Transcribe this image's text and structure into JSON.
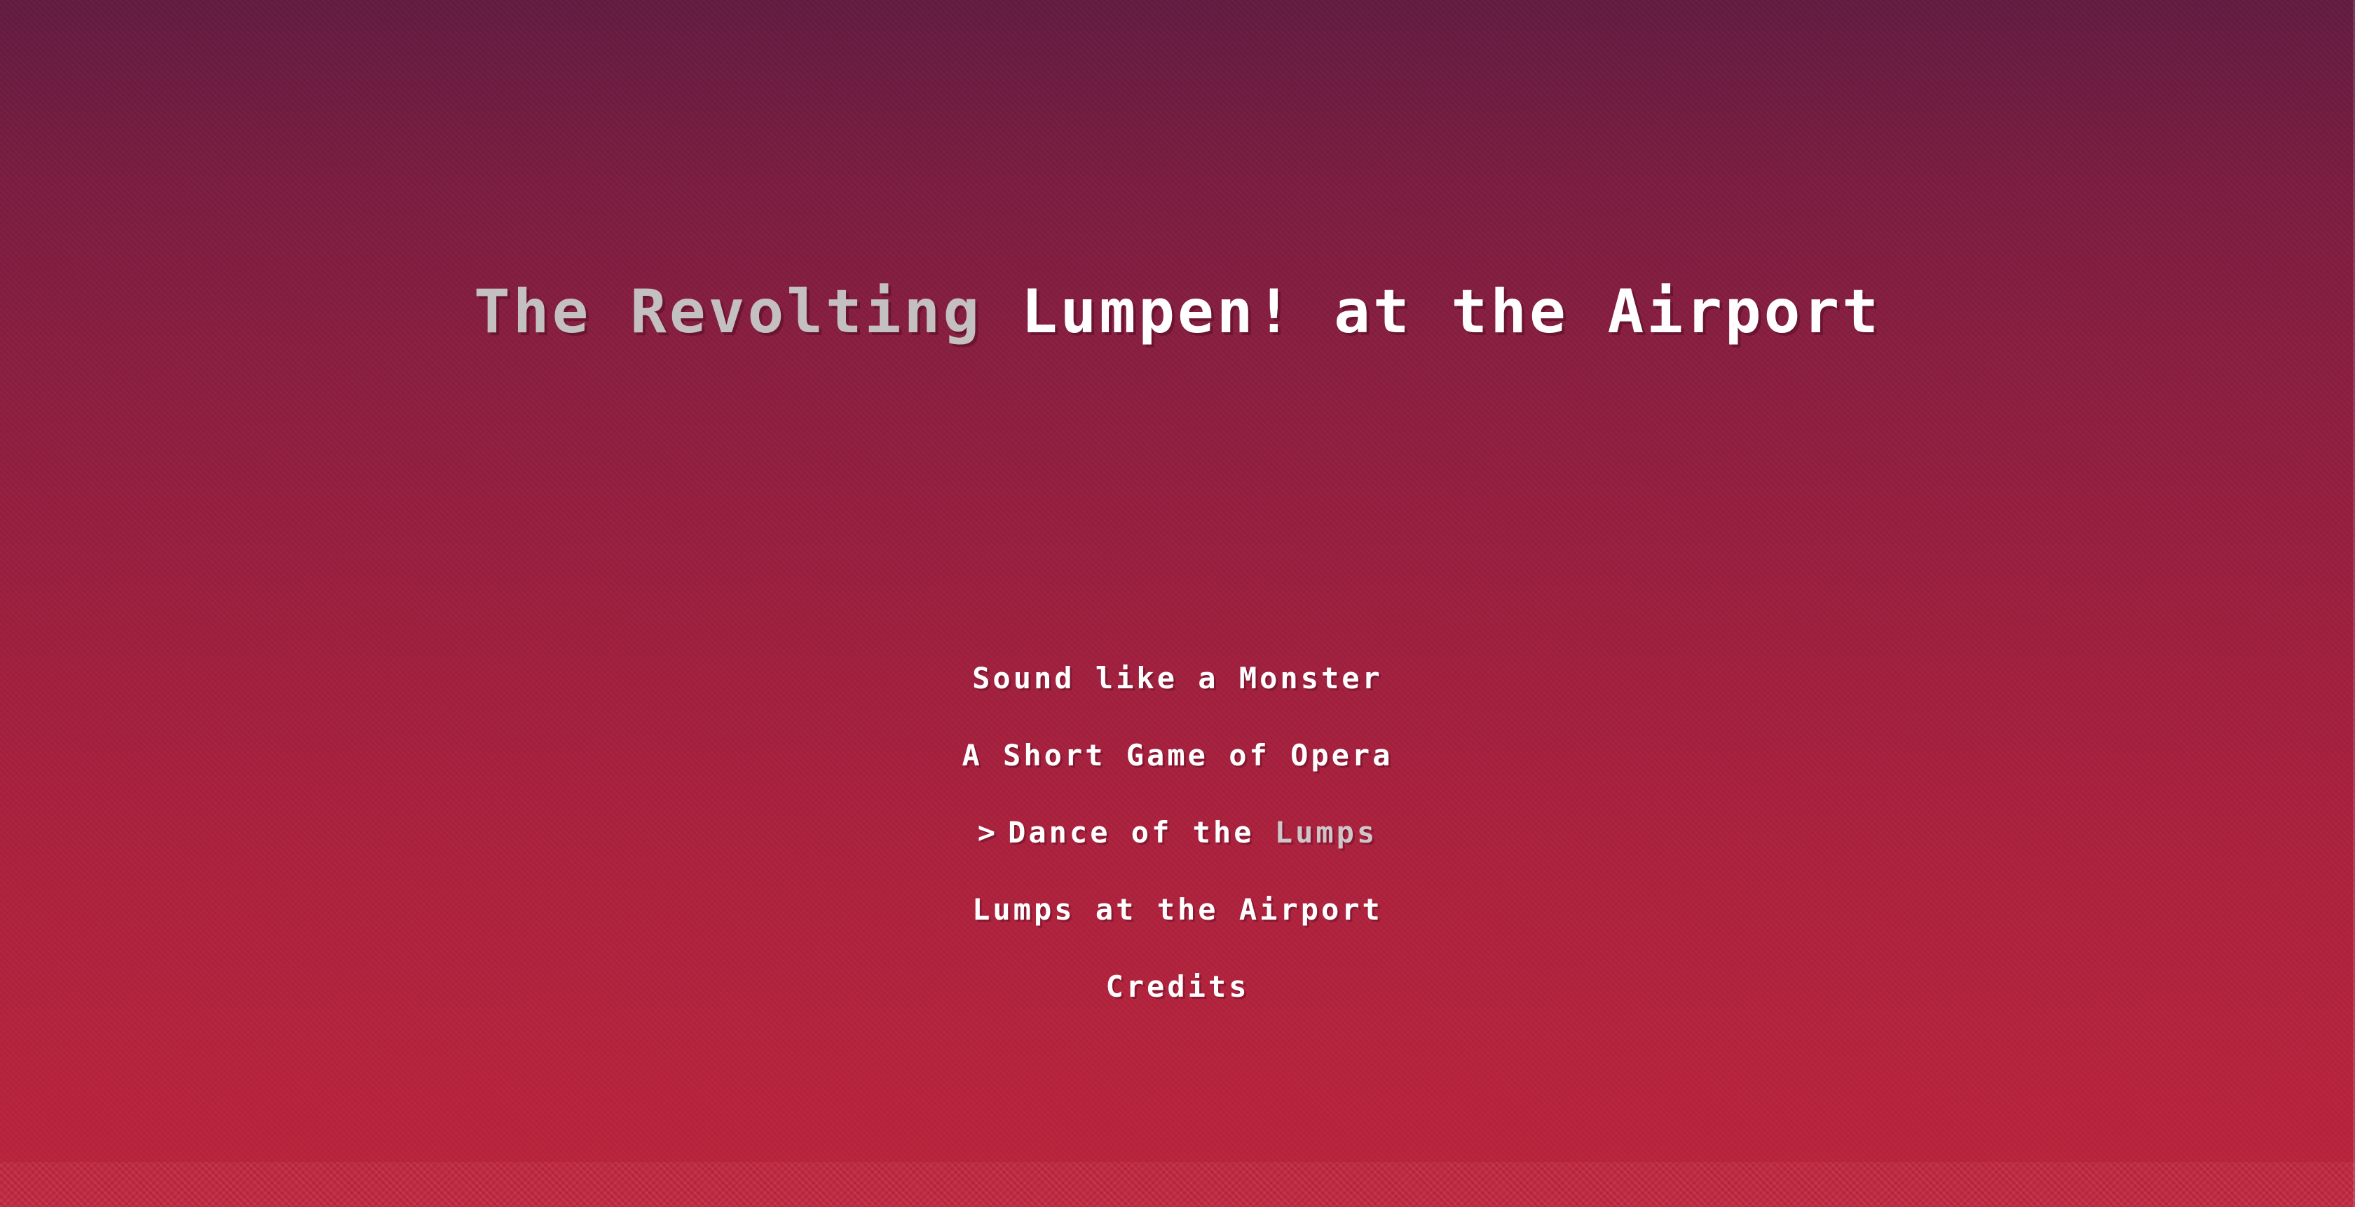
{
  "title": {
    "dim_part": "The Revolting",
    "bright_part": "Lumpen! at the Airport"
  },
  "menu": {
    "cursor": ">",
    "items": [
      {
        "label": "Sound like a Monster"
      },
      {
        "label": "A Short Game of Opera"
      },
      {
        "label_bright": "Dance of the",
        "label_dim": "Lumps",
        "selected": true
      },
      {
        "label": "Lumps at the Airport"
      },
      {
        "label": "Credits"
      }
    ]
  },
  "colors": {
    "background_top": "#621c41",
    "background_bottom": "#b8243c",
    "text": "#ffffff",
    "text_dim": "#c4c0c2"
  }
}
